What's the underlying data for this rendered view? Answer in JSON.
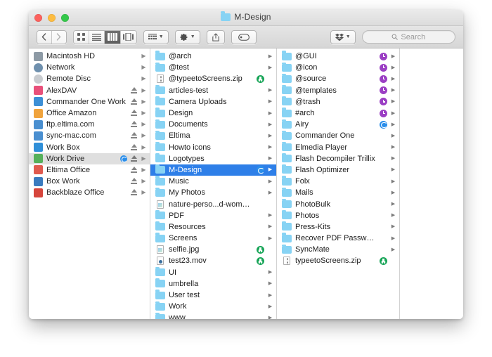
{
  "window": {
    "title": "M-Design",
    "title_icon": "folder-icon",
    "traffic_lights": [
      "close-button",
      "minimize-button",
      "zoom-button"
    ]
  },
  "toolbar": {
    "nav": [
      {
        "name": "back-button",
        "glyph": "‹",
        "enabled": true
      },
      {
        "name": "forward-button",
        "glyph": "›",
        "enabled": false
      }
    ],
    "view_modes": [
      {
        "name": "icon-view-button",
        "label": "Icon view",
        "active": false
      },
      {
        "name": "list-view-button",
        "label": "List view",
        "active": false
      },
      {
        "name": "column-view-button",
        "label": "Column view",
        "active": true
      },
      {
        "name": "coverflow-view-button",
        "label": "Cover Flow view",
        "active": false
      }
    ],
    "arrange_button": {
      "name": "arrange-button",
      "label": "Arrange"
    },
    "action_button": {
      "name": "action-gear-button",
      "label": "Action"
    },
    "share_button": {
      "name": "share-button",
      "label": "Share"
    },
    "tags_button": {
      "name": "tags-button",
      "label": "Edit Tags"
    },
    "dropbox_button": {
      "name": "dropbox-button",
      "label": "Dropbox"
    },
    "search": {
      "placeholder": "Search",
      "value": ""
    }
  },
  "sidebar": {
    "items": [
      {
        "label": "Macintosh HD",
        "icon": "hard-drive-icon",
        "color": "#8d9aa5",
        "eject": false,
        "disclosure": true,
        "sync": false,
        "selected": false
      },
      {
        "label": "Network",
        "icon": "network-globe-icon",
        "color": "#6f90ae",
        "eject": false,
        "disclosure": true,
        "sync": false,
        "selected": false
      },
      {
        "label": "Remote Disc",
        "icon": "optical-disc-icon",
        "color": "#c9ccd0",
        "eject": false,
        "disclosure": true,
        "sync": false,
        "selected": false
      },
      {
        "label": "AlexDAV",
        "icon": "webdav-server-icon",
        "color": "#e8507a",
        "eject": true,
        "disclosure": true,
        "sync": false,
        "selected": false
      },
      {
        "label": "Commander One Work",
        "icon": "commander-one-icon",
        "color": "#3c8fd6",
        "eject": true,
        "disclosure": true,
        "sync": false,
        "selected": false
      },
      {
        "label": "Office Amazon",
        "icon": "amazon-s3-icon",
        "color": "#f0a33c",
        "eject": true,
        "disclosure": true,
        "sync": false,
        "selected": false
      },
      {
        "label": "ftp.eltima.com",
        "icon": "ftp-server-icon",
        "color": "#4a8fd0",
        "eject": true,
        "disclosure": true,
        "sync": false,
        "selected": false
      },
      {
        "label": "sync-mac.com",
        "icon": "ftp-server-icon",
        "color": "#4a8fd0",
        "eject": true,
        "disclosure": true,
        "sync": false,
        "selected": false
      },
      {
        "label": "Work Box",
        "icon": "box-drive-icon",
        "color": "#2f8fd8",
        "eject": true,
        "disclosure": true,
        "sync": false,
        "selected": false
      },
      {
        "label": "Work Drive",
        "icon": "google-drive-icon",
        "color": "#55b05a",
        "eject": true,
        "disclosure": true,
        "sync": true,
        "selected": true
      },
      {
        "label": "Eltima Office",
        "icon": "network-share-icon",
        "color": "#e05a4e",
        "eject": true,
        "disclosure": true,
        "sync": false,
        "selected": false
      },
      {
        "label": "Box Work",
        "icon": "box-server-icon",
        "color": "#3a7bbf",
        "eject": true,
        "disclosure": true,
        "sync": false,
        "selected": false
      },
      {
        "label": "Backblaze Office",
        "icon": "backblaze-icon",
        "color": "#d6453c",
        "eject": true,
        "disclosure": true,
        "sync": false,
        "selected": false
      }
    ]
  },
  "columns": [
    {
      "name": "column-one",
      "items": [
        {
          "label": "@arch",
          "type": "folder",
          "disclosure": true,
          "badge": null,
          "selected": false
        },
        {
          "label": "@test",
          "type": "folder",
          "disclosure": true,
          "badge": null,
          "selected": false
        },
        {
          "label": "@typeetoScreens.zip",
          "type": "zip",
          "disclosure": false,
          "badge": "download",
          "selected": false
        },
        {
          "label": "articles-test",
          "type": "folder",
          "disclosure": true,
          "badge": null,
          "selected": false
        },
        {
          "label": "Camera Uploads",
          "type": "folder",
          "disclosure": true,
          "badge": null,
          "selected": false
        },
        {
          "label": "Design",
          "type": "folder",
          "disclosure": true,
          "badge": null,
          "selected": false
        },
        {
          "label": "Documents",
          "type": "folder",
          "disclosure": true,
          "badge": null,
          "selected": false
        },
        {
          "label": "Eltima",
          "type": "folder",
          "disclosure": true,
          "badge": null,
          "selected": false
        },
        {
          "label": "Howto icons",
          "type": "folder",
          "disclosure": true,
          "badge": null,
          "selected": false
        },
        {
          "label": "Logotypes",
          "type": "folder",
          "disclosure": true,
          "badge": null,
          "selected": false
        },
        {
          "label": "M-Design",
          "type": "folder",
          "disclosure": true,
          "badge": "sync",
          "selected": true
        },
        {
          "label": "Music",
          "type": "folder",
          "disclosure": true,
          "badge": null,
          "selected": false
        },
        {
          "label": "My Photos",
          "type": "folder",
          "disclosure": true,
          "badge": null,
          "selected": false
        },
        {
          "label": "nature-perso...d-woman.jpg",
          "type": "image",
          "disclosure": false,
          "badge": null,
          "selected": false
        },
        {
          "label": "PDF",
          "type": "folder",
          "disclosure": true,
          "badge": null,
          "selected": false
        },
        {
          "label": "Resources",
          "type": "folder",
          "disclosure": true,
          "badge": null,
          "selected": false
        },
        {
          "label": "Screens",
          "type": "folder",
          "disclosure": true,
          "badge": null,
          "selected": false
        },
        {
          "label": "selfie.jpg",
          "type": "image",
          "disclosure": false,
          "badge": "download",
          "selected": false
        },
        {
          "label": "test23.mov",
          "type": "movie",
          "disclosure": false,
          "badge": "download",
          "selected": false
        },
        {
          "label": "UI",
          "type": "folder",
          "disclosure": true,
          "badge": null,
          "selected": false
        },
        {
          "label": "umbrella",
          "type": "folder",
          "disclosure": true,
          "badge": null,
          "selected": false
        },
        {
          "label": "User test",
          "type": "folder",
          "disclosure": true,
          "badge": null,
          "selected": false
        },
        {
          "label": "Work",
          "type": "folder",
          "disclosure": true,
          "badge": null,
          "selected": false
        },
        {
          "label": "www",
          "type": "folder",
          "disclosure": true,
          "badge": null,
          "selected": false
        }
      ]
    },
    {
      "name": "column-two",
      "items": [
        {
          "label": "@GUI",
          "type": "folder",
          "disclosure": true,
          "badge": "clock",
          "selected": false
        },
        {
          "label": "@icon",
          "type": "folder",
          "disclosure": true,
          "badge": "clock",
          "selected": false
        },
        {
          "label": "@source",
          "type": "folder",
          "disclosure": true,
          "badge": "clock",
          "selected": false
        },
        {
          "label": "@templates",
          "type": "folder",
          "disclosure": true,
          "badge": "clock",
          "selected": false
        },
        {
          "label": "@trash",
          "type": "folder",
          "disclosure": true,
          "badge": "clock",
          "selected": false
        },
        {
          "label": "#arch",
          "type": "folder",
          "disclosure": true,
          "badge": "clock",
          "selected": false
        },
        {
          "label": "Airy",
          "type": "folder",
          "disclosure": true,
          "badge": "sync",
          "selected": false
        },
        {
          "label": "Commander One",
          "type": "folder",
          "disclosure": true,
          "badge": null,
          "selected": false
        },
        {
          "label": "Elmedia Player",
          "type": "folder",
          "disclosure": true,
          "badge": null,
          "selected": false
        },
        {
          "label": "Flash Decompiler Trillix",
          "type": "folder",
          "disclosure": true,
          "badge": null,
          "selected": false
        },
        {
          "label": "Flash Optimizer",
          "type": "folder",
          "disclosure": true,
          "badge": null,
          "selected": false
        },
        {
          "label": "Folx",
          "type": "folder",
          "disclosure": true,
          "badge": null,
          "selected": false
        },
        {
          "label": "Mails",
          "type": "folder",
          "disclosure": true,
          "badge": null,
          "selected": false
        },
        {
          "label": "PhotoBulk",
          "type": "folder",
          "disclosure": true,
          "badge": null,
          "selected": false
        },
        {
          "label": "Photos",
          "type": "folder",
          "disclosure": true,
          "badge": null,
          "selected": false
        },
        {
          "label": "Press-Kits",
          "type": "folder",
          "disclosure": true,
          "badge": null,
          "selected": false
        },
        {
          "label": "Recover PDF Password",
          "type": "folder",
          "disclosure": true,
          "badge": null,
          "selected": false
        },
        {
          "label": "SyncMate",
          "type": "folder",
          "disclosure": true,
          "badge": null,
          "selected": false
        },
        {
          "label": "typeetoScreens.zip",
          "type": "zip",
          "disclosure": false,
          "badge": "download",
          "selected": false
        }
      ]
    },
    {
      "name": "column-three",
      "items": []
    }
  ]
}
